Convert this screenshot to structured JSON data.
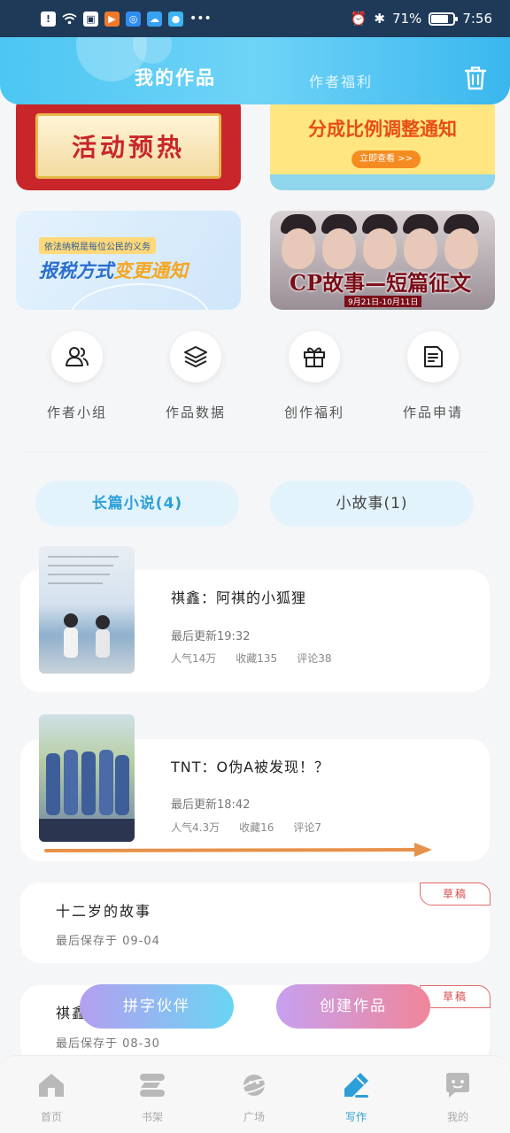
{
  "status_bar": {
    "battery": "71%",
    "time": "7:56"
  },
  "header": {
    "tab_mine": "我的作品",
    "tab_welfare": "作者福利",
    "trash_icon": "trash-icon"
  },
  "banners": [
    {
      "text": "活动预热",
      "colors": {
        "bg": "#c8262a",
        "fg": "#c8262a"
      }
    },
    {
      "text": "分成比例调整通知",
      "button": "立即查看 >>"
    },
    {
      "tag": "依法纳税是每位公民的义务",
      "text_blue": "报税方式",
      "text_orange": "变更通知"
    },
    {
      "text": "CP故事—短篇征文",
      "date": "9月21日-10月11日"
    }
  ],
  "quick_entries": [
    {
      "label": "作者小组",
      "icon": "users-icon"
    },
    {
      "label": "作品数据",
      "icon": "layers-icon"
    },
    {
      "label": "创作福利",
      "icon": "gift-icon"
    },
    {
      "label": "作品申请",
      "icon": "document-icon"
    }
  ],
  "content_tabs": {
    "novels": "长篇小说(4)",
    "stories": "小故事(1)"
  },
  "works": [
    {
      "title": "祺鑫：阿祺的小狐狸",
      "updated": "最后更新19:32",
      "popularity": "人气14万",
      "favorites": "收藏135",
      "comments": "评论38"
    },
    {
      "title": "TNT：O伪A被发现！？",
      "updated": "最后更新18:42",
      "popularity": "人气4.3万",
      "favorites": "收藏16",
      "comments": "评论7"
    }
  ],
  "drafts": [
    {
      "title": "十二岁的故事",
      "saved": "最后保存于 09-04",
      "tag": "草稿"
    },
    {
      "title": "祺鑫",
      "saved": "最后保存于 08-30",
      "tag": "草稿"
    }
  ],
  "floating_buttons": {
    "partner": "拼字伙伴",
    "create": "创建作品"
  },
  "bottom_nav": [
    {
      "label": "首页",
      "icon": "home-icon"
    },
    {
      "label": "书架",
      "icon": "bookshelf-icon"
    },
    {
      "label": "广场",
      "icon": "planet-icon"
    },
    {
      "label": "写作",
      "icon": "pen-icon"
    },
    {
      "label": "我的",
      "icon": "chat-face-icon"
    }
  ],
  "colors": {
    "accent": "#2d9fd8",
    "header": "#4cc6f2",
    "draft": "#d94b4b",
    "arrow": "#e8914a"
  }
}
